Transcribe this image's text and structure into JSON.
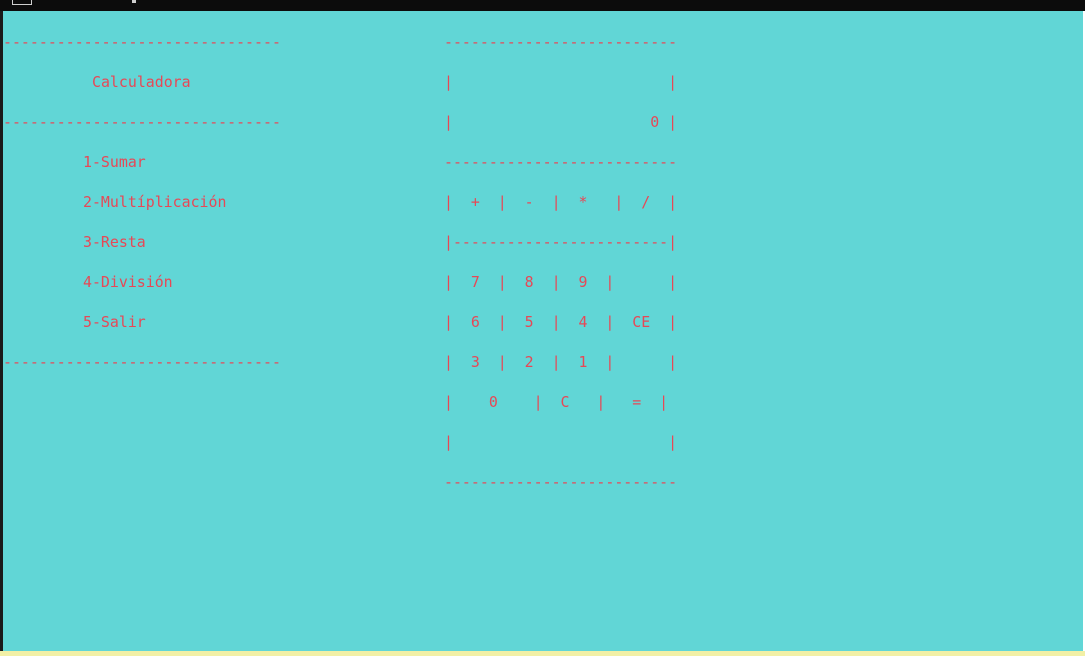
{
  "window": {
    "background": "#61d6d6",
    "text_color": "#e74856"
  },
  "menu": {
    "separator_top": "-------------------------------",
    "title": "Calculadora",
    "separator_mid": "-------------------------------",
    "items": [
      "1-Sumar",
      "2-Multíplicación",
      "3-Resta",
      "4-División",
      "5-Salir"
    ],
    "separator_bottom": "-------------------------------"
  },
  "calculator": {
    "rows": [
      "--------------------------",
      "|                        |",
      "|                      0 |",
      "--------------------------",
      "|  +  |  -  |  *   |  /  |",
      "|------------------------|",
      "|  7  |  8  |  9  |      |",
      "|  6  |  5  |  4  |  CE  |",
      "|  3  |  2  |  1  |      |",
      "|    0    |  C   |   =  |",
      "|                        |",
      "--------------------------"
    ]
  }
}
